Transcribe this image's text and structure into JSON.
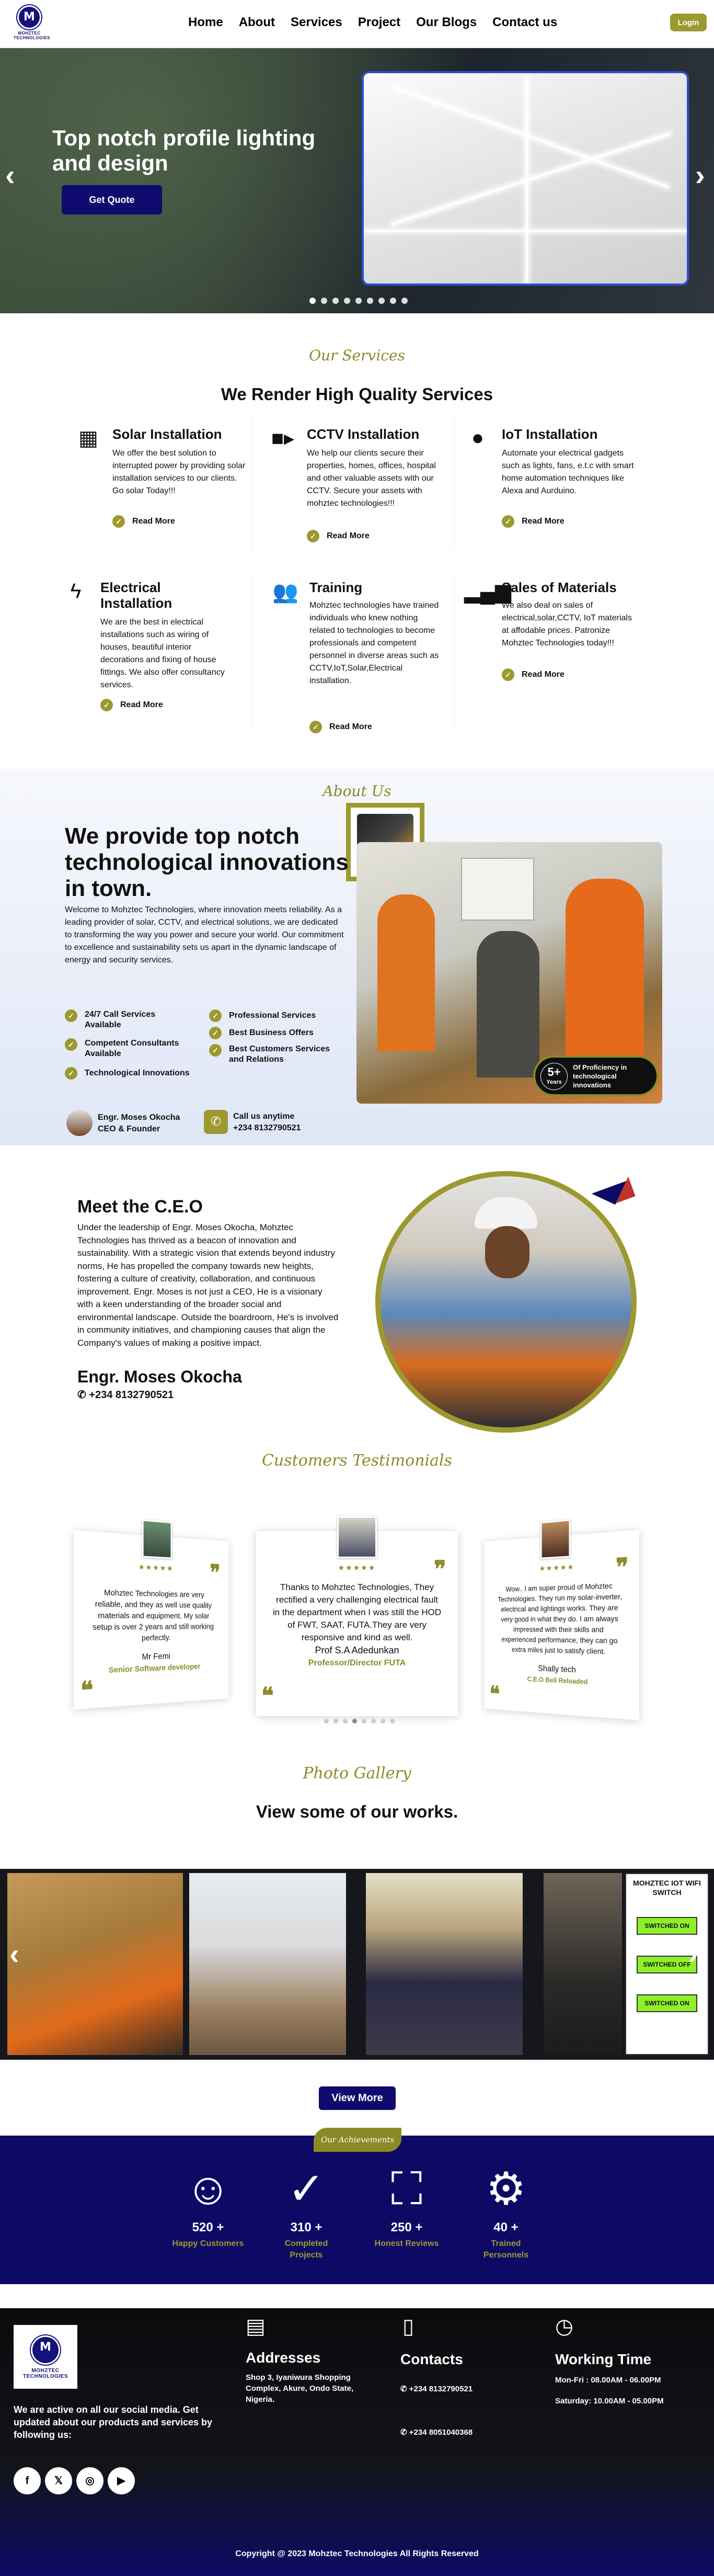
{
  "brand": {
    "logo_text": "MOHZTEC TECHNOLOGIES",
    "logo_letter": "M"
  },
  "nav": {
    "items": [
      "Home",
      "About",
      "Services",
      "Project",
      "Our Blogs",
      "Contact us"
    ],
    "login": "Login"
  },
  "hero": {
    "title": "Top notch profile lighting and design",
    "button": "Get Quote",
    "prev": "‹",
    "next": "›",
    "dots": 9
  },
  "services": {
    "script": "Our Services",
    "heading": "We Render High Quality Services",
    "items": [
      {
        "icon": "solar-panel-icon",
        "title": "Solar Installation",
        "text": "We offer the best solution to interrupted power by providing solar installation services to our clients. Go solar Today!!!",
        "more": "Read More"
      },
      {
        "icon": "video-camera-icon",
        "title": "CCTV Installation",
        "text": "We help our clients secure their properties, homes, offices, hospital and other valuable assets with our CCTV. Secure your assets with mohztec technologies!!!",
        "more": "Read More"
      },
      {
        "icon": "globe-icon",
        "title": "IoT Installation",
        "text": "Automate your electrical gadgets such as lights, fans, e.t.c with smart home automation techniques like Alexa and Aurduino.",
        "more": "Read More"
      },
      {
        "icon": "lightning-icon",
        "title": "Electrical Installation",
        "text": "We are the best in electrical installations such as wiring of houses, beautiful interior decorations and fixing of house fittings. We also offer consultancy services.",
        "more": "Read More"
      },
      {
        "icon": "people-icon",
        "title": "Training",
        "text": "Mohztec technologies have trained individuals who knew nothing related to technologies to become professionals and competent personnel in diverse areas such as CCTV,IoT,Solar,Electrical installation.",
        "more": "Read More"
      },
      {
        "icon": "bar-chart-icon",
        "title": "Sales of Materials",
        "text": "We also deal on sales of electrical,solar,CCTV, IoT materials at affodable prices. Patronize Mohztec Technologies today!!!",
        "more": "Read More"
      }
    ]
  },
  "about": {
    "script": "About Us",
    "title": "We provide top notch technological innovations in town.",
    "text": "Welcome to Mohztec Technologies, where innovation meets reliability. As a leading provider of solar, CCTV, and electrical solutions, we are dedicated to transforming the way you power and secure your world. Our commitment to excellence and sustainability sets us apart in the dynamic landscape of energy and security services.",
    "features_left": [
      "24/7 Call Services Available",
      "Competent Consultants Available",
      "Technological Innovations"
    ],
    "features_right": [
      "Professional Services",
      "Best Business Offers",
      "Best Customers Services and Relations"
    ],
    "exp_number": "5+",
    "exp_unit": "Years",
    "exp_text": "Of Proficiency in technological innovations",
    "ceo_name": "Engr. Moses Okocha",
    "ceo_role": "CEO & Founder",
    "call_label": "Call us anytime",
    "call_number": "+234 8132790521"
  },
  "ceo": {
    "title": "Meet the C.E.O",
    "text": "Under the leadership of Engr. Moses Okocha, Mohztec Technologies has thrived as a beacon of innovation and sustainability. With a strategic vision that extends beyond industry norms, He has propelled the company towards new heights, fostering a culture of creativity, collaboration, and continuous improvement. Engr. Moses is not just a CEO, He is a visionary with a keen understanding of the broader social and environmental landscape. Outside the boardroom, He's is involved in community initiatives, and championing causes that align the Company's values of making a positive impact.",
    "name": "Engr. Moses Okocha",
    "phone": "+234 8132790521"
  },
  "testimonials": {
    "script": "Customers Testimonials",
    "items": [
      {
        "quote": "Mohztec Technologies are very reliable, and they as well use quality materials and equipment. My solar setup is over 2 years and still working perfectly.",
        "name": "Mr Femi",
        "role": "Senior Software developer"
      },
      {
        "quote": "Thanks to Mohztec Technologies, They rectified a very challenging electrical fault in the department when I was still the HOD of FWT, SAAT, FUTA.They are very responsive and kind as well.",
        "name": "Prof S.A Adedunkan",
        "role": "Professor/Director FUTA"
      },
      {
        "quote": "Wow.. I am super proud of Mohztec Technologies. They run my solar-inverter, electrical and lightings works. They are very good in what they do. I am always impressed with their skills and experienced performance, they can go extra miles just to satisfy client.",
        "name": "Shally tech",
        "role": "C.E.O Bell Reloaded"
      }
    ],
    "stars": "★★★★★"
  },
  "gallery": {
    "script": "Photo Gallery",
    "heading": "View some of our works.",
    "button": "View More",
    "switch_title": "MOHZTEC IOT WIFI SWITCH",
    "switch_labels": [
      "SWITCHED ON",
      "SWITCHED OFF",
      "SWITCHED ON"
    ]
  },
  "achievements": {
    "tag": "Our Achievements",
    "items": [
      {
        "icon": "smiley-icon",
        "number": "520 +",
        "label": "Happy Customers"
      },
      {
        "icon": "check-circle-icon",
        "number": "310 +",
        "label": "Completed Projects"
      },
      {
        "icon": "presenter-icon",
        "number": "250 +",
        "label": "Honest Reviews"
      },
      {
        "icon": "user-gear-icon",
        "number": "40 +",
        "label": "Trained Personnels"
      }
    ]
  },
  "footer": {
    "social_text": "We are active on all our social media. Get updated about our products and services by following us:",
    "addresses_title": "Addresses",
    "address": "Shop 3, Iyaniwura Shopping Complex, Akure, Ondo State, Nigeria.",
    "contacts_title": "Contacts",
    "phone1": "+234 8132790521",
    "phone2": "+234 8051040368",
    "working_title": "Working Time",
    "hours1": "Mon-Fri : 08.00AM - 06.00PM",
    "hours2": "Saturday: 10.00AM - 05.00PM",
    "copyright": "Copyright @ 2023 Mohztec Technologies All Rights Reserved"
  },
  "colors": {
    "olive": "#9c9a2f",
    "navy": "#0d0a66"
  }
}
